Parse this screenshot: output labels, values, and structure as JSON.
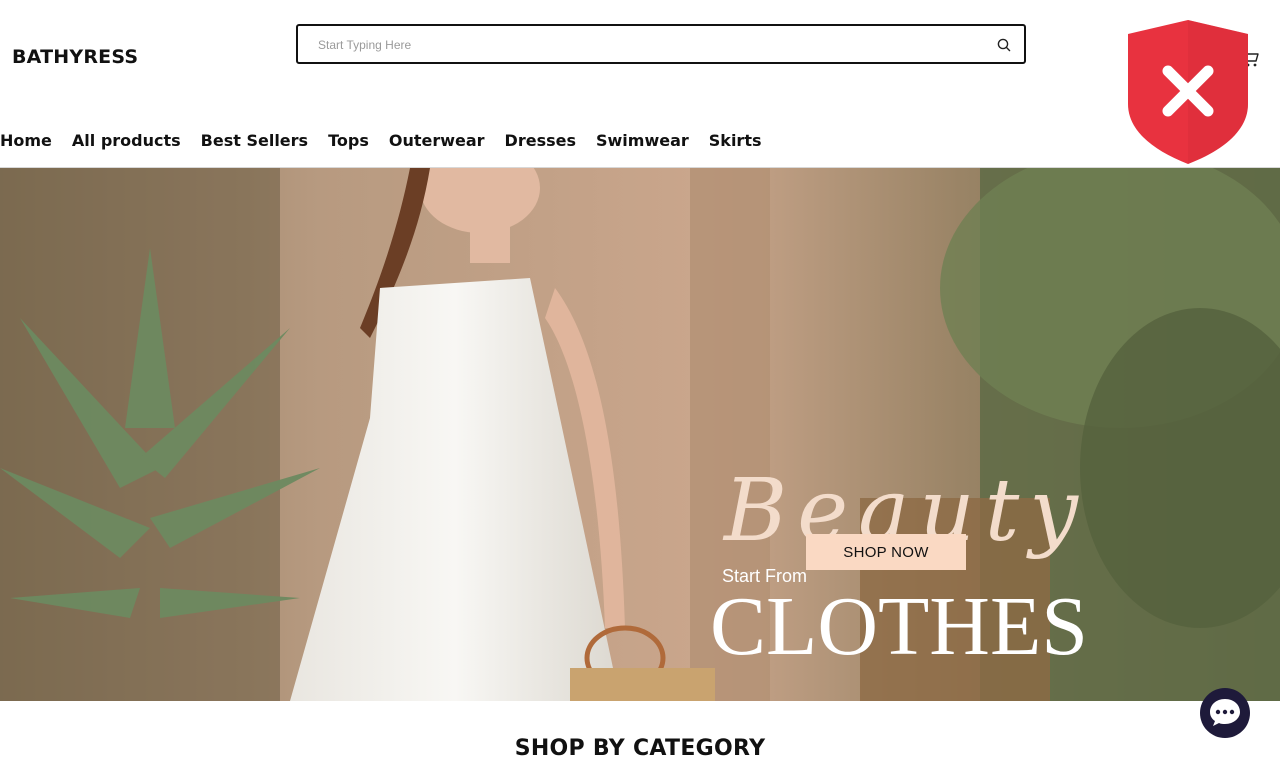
{
  "brand": {
    "name": "BATHYRESS"
  },
  "search": {
    "placeholder": "Start Typing Here"
  },
  "nav": {
    "items": [
      {
        "label": "Home"
      },
      {
        "label": "All products"
      },
      {
        "label": "Best Sellers"
      },
      {
        "label": "Tops"
      },
      {
        "label": "Outerwear"
      },
      {
        "label": "Dresses"
      },
      {
        "label": "Swimwear"
      },
      {
        "label": "Skirts"
      }
    ]
  },
  "hero": {
    "script_text": "Beauty",
    "subtitle": "Start From",
    "title": "CLOTHES",
    "button_label": "SHOP NOW"
  },
  "section": {
    "title": "SHOP BY CATEGORY"
  },
  "icons": {
    "search": "search-icon",
    "cart": "cart-icon",
    "security_warning": "shield-x-icon",
    "chat": "chat-icon"
  },
  "colors": {
    "shield_red": "#e8323f",
    "button_peach": "#fad9c3",
    "chat_bg": "#1e1a3a"
  }
}
